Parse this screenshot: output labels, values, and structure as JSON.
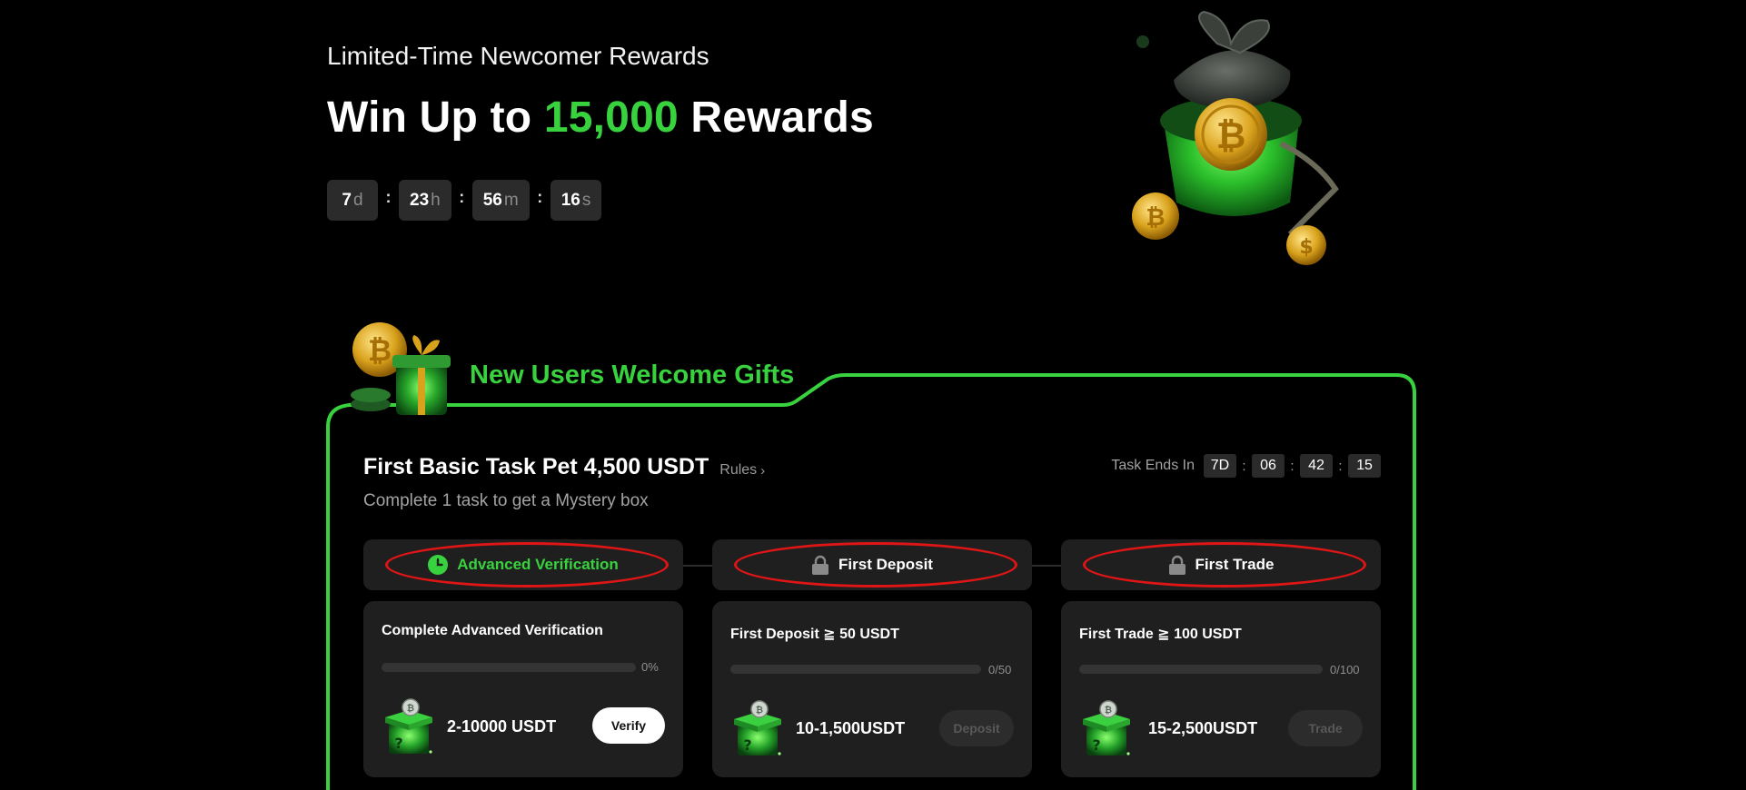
{
  "hero": {
    "subtitle": "Limited-Time Newcomer Rewards",
    "title_prefix": "Win Up to",
    "title_highlight": "15,000",
    "title_suffix": "Rewards",
    "countdown": [
      {
        "value": "7",
        "unit": "d"
      },
      {
        "value": "23",
        "unit": "h"
      },
      {
        "value": "56",
        "unit": "m"
      },
      {
        "value": "16",
        "unit": "s"
      }
    ],
    "separator": ":"
  },
  "welcome": {
    "title": "New Users Welcome Gifts"
  },
  "task": {
    "title": "First Basic Task Pet 4,500 USDT",
    "rules_label": "Rules",
    "description": "Complete 1 task to get a Mystery box",
    "ends_label": "Task Ends In",
    "ends_countdown": [
      "7D",
      "06",
      "42",
      "15"
    ],
    "separator": ":"
  },
  "steps": [
    {
      "label": "Advanced Verification",
      "icon": "clock-icon",
      "status": "in-progress"
    },
    {
      "label": "First Deposit",
      "icon": "lock-icon",
      "status": "locked"
    },
    {
      "label": "First Trade",
      "icon": "lock-icon",
      "status": "locked"
    }
  ],
  "cards": [
    {
      "title": "Complete Advanced Verification",
      "progress_text": "0%",
      "progress": 0,
      "reward": "2-10000 USDT",
      "button": "Verify",
      "button_enabled": true
    },
    {
      "title": "First  Deposit  ≧ 50 USDT",
      "progress_text": "0/50",
      "progress": 0,
      "reward": "10-1,500USDT",
      "button": "Deposit",
      "button_enabled": false
    },
    {
      "title": "First Trade  ≧ 100 USDT",
      "progress_text": "0/100",
      "progress": 0,
      "reward": "15-2,500USDT",
      "button": "Trade",
      "button_enabled": false
    }
  ],
  "colors": {
    "accent": "#39d23f",
    "background": "#000000",
    "card": "#1f1f1f",
    "highlight_oval": "#e01515"
  }
}
